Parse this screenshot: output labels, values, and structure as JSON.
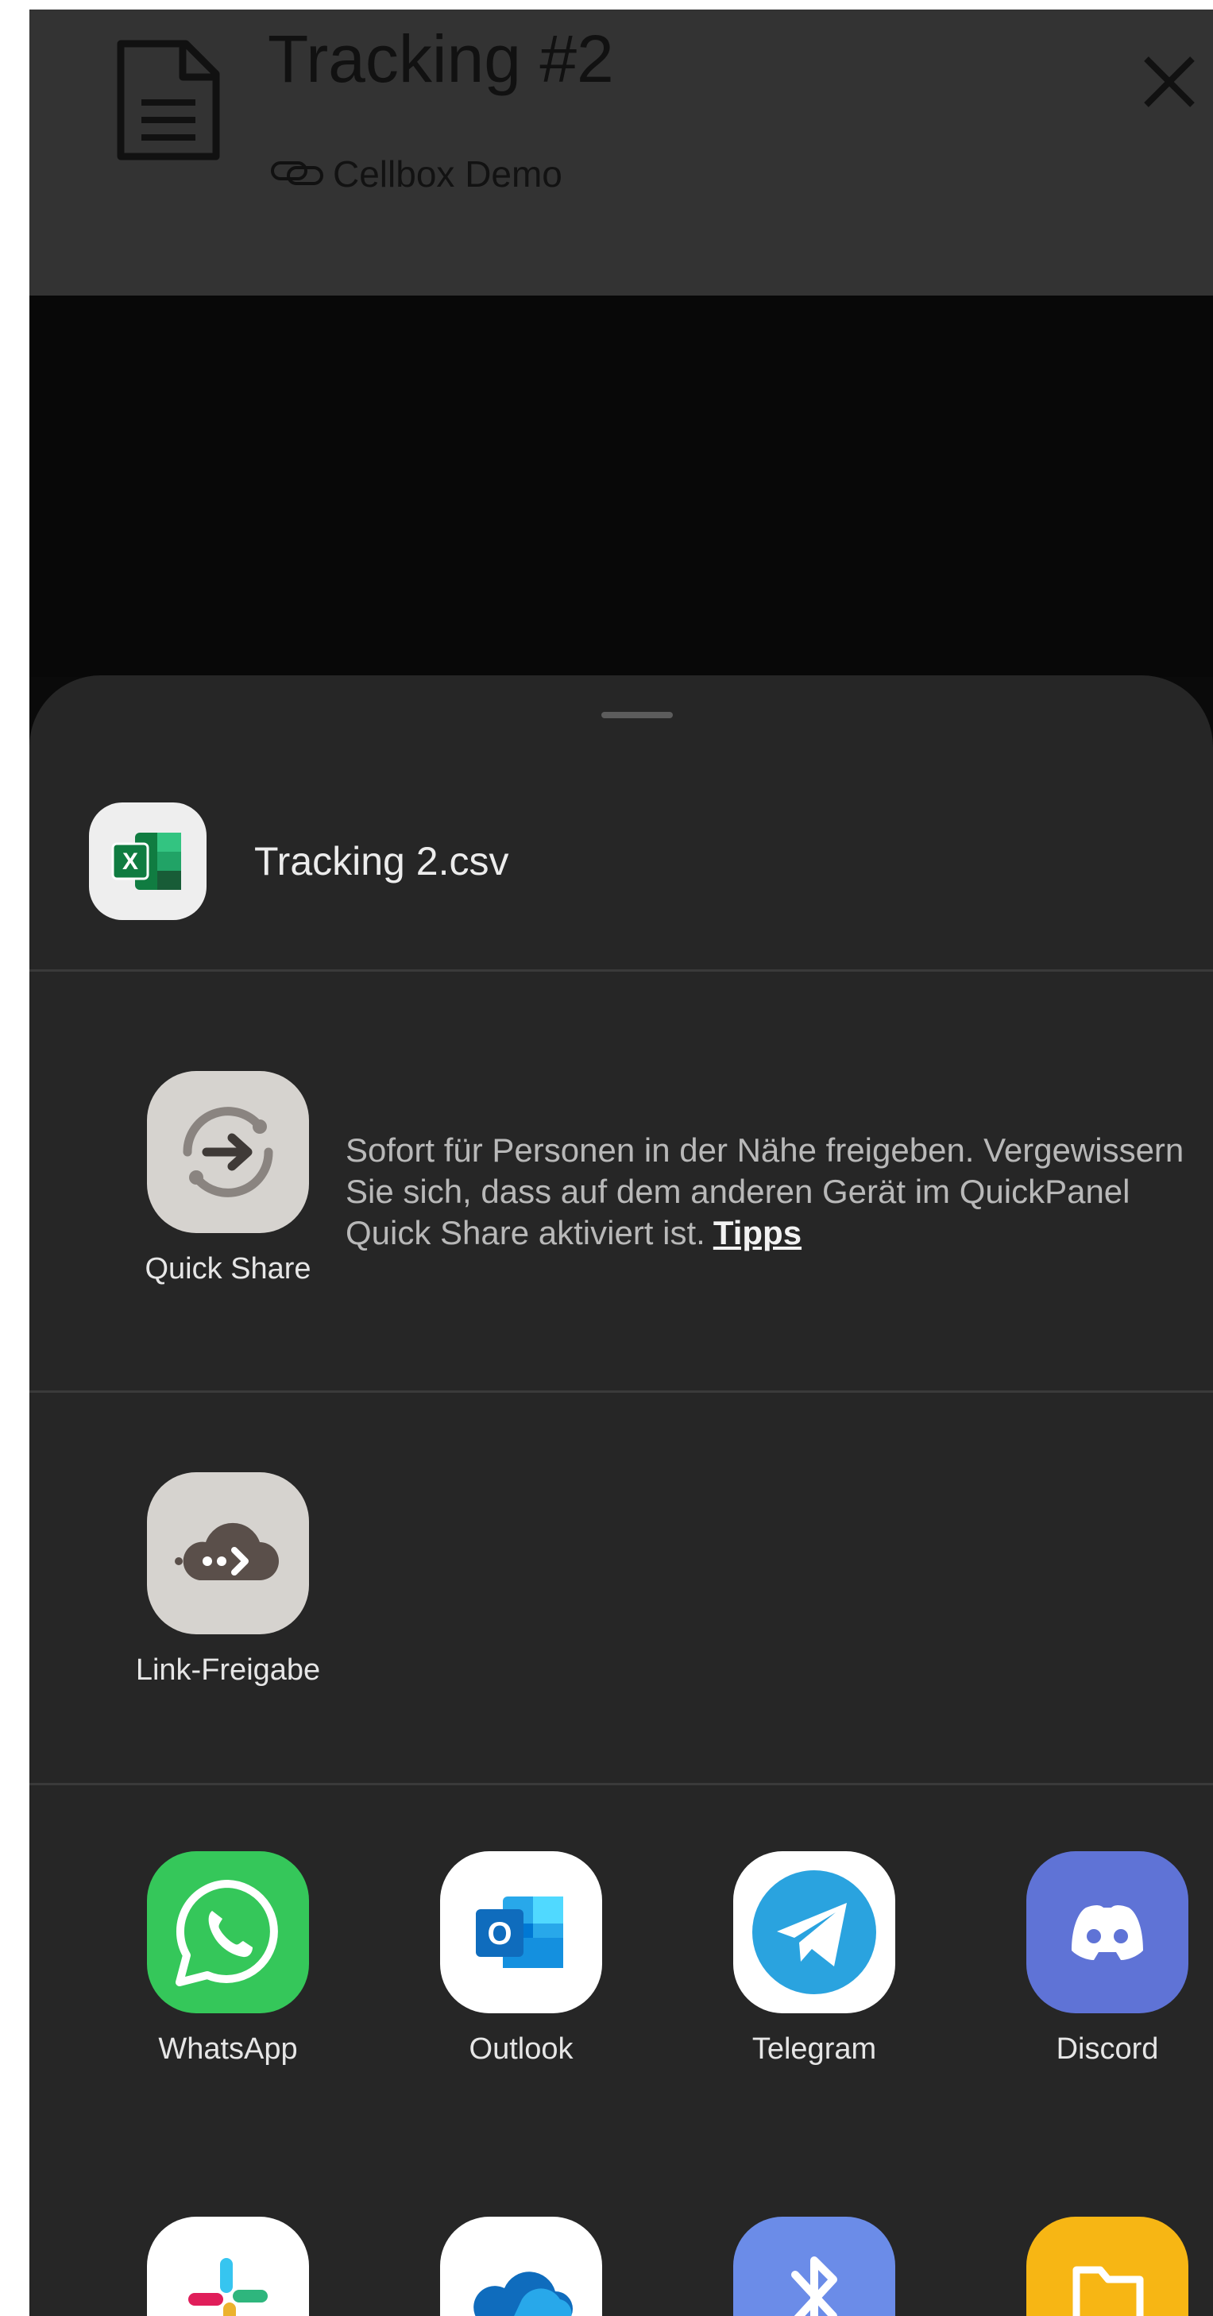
{
  "header": {
    "title": "Tracking #2",
    "subtitle": "Cellbox Demo"
  },
  "share_sheet": {
    "file_name": "Tracking 2.csv",
    "quick_share": {
      "label": "Quick Share",
      "description_line1": "Sofort für Personen in der Nähe freigeben. Vergewissern",
      "description_line2": "Sie sich, dass auf dem anderen Gerät im QuickPanel",
      "description_line3": "Quick Share aktiviert ist.",
      "tips_link": "Tipps"
    },
    "link_share": {
      "label": "Link-Freigabe"
    },
    "apps": [
      {
        "label": "WhatsApp",
        "icon": "whatsapp-icon",
        "color": "#35c75a"
      },
      {
        "label": "Outlook",
        "icon": "outlook-icon",
        "color": "#0f6cbd"
      },
      {
        "label": "Telegram",
        "icon": "telegram-icon",
        "color": "#2aa3df"
      },
      {
        "label": "Discord",
        "icon": "discord-icon",
        "color": "#5f73d6"
      }
    ],
    "apps_row2": [
      {
        "icon": "slack-icon"
      },
      {
        "icon": "onedrive-icon"
      },
      {
        "icon": "bluetooth-icon",
        "color": "#6b8ce8"
      },
      {
        "icon": "folder-icon",
        "color": "#f7b614"
      }
    ]
  }
}
